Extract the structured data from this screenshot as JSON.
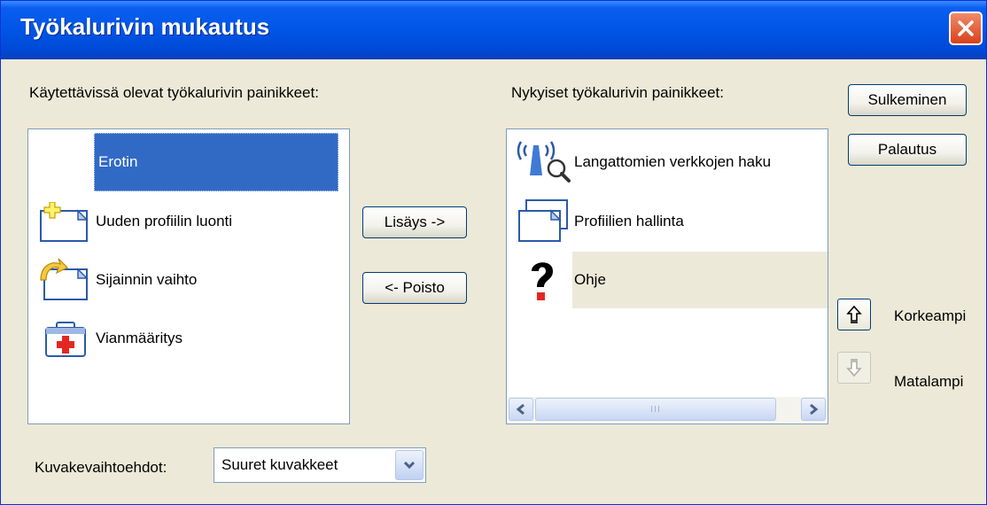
{
  "window": {
    "title": "Työkalurivin mukautus"
  },
  "available": {
    "label": "Käytettävissä olevat työkalurivin painikkeet:",
    "items": [
      {
        "label": "Erotin",
        "icon": "separator",
        "selected": true
      },
      {
        "label": "Uuden profiilin luonti",
        "icon": "new-profile-icon"
      },
      {
        "label": "Sijainnin vaihto",
        "icon": "switch-location-icon"
      },
      {
        "label": "Vianmääritys",
        "icon": "diagnostics-icon"
      }
    ]
  },
  "current": {
    "label": "Nykyiset työkalurivin painikkeet:",
    "items": [
      {
        "label": "Langattomien verkkojen haku",
        "icon": "wireless-scan-icon"
      },
      {
        "label": "Profiilien hallinta",
        "icon": "manage-profiles-icon"
      },
      {
        "label": "Ohje",
        "icon": "help-icon",
        "selected": true
      }
    ],
    "scrollbar": {
      "grip": "III"
    }
  },
  "buttons": {
    "add": "Lisäys ->",
    "remove": "<- Poisto",
    "close": "Sulkeminen",
    "reset": "Palautus",
    "up": "Korkeampi",
    "down": "Matalampi"
  },
  "icon_options": {
    "label": "Kuvakevaihtoehdot:",
    "value": "Suuret kuvakkeet"
  },
  "colors": {
    "selection": "#316ac5",
    "selection_inactive": "#ece9d8",
    "title_bar": "#0055e5",
    "close_red": "#d9411a"
  }
}
